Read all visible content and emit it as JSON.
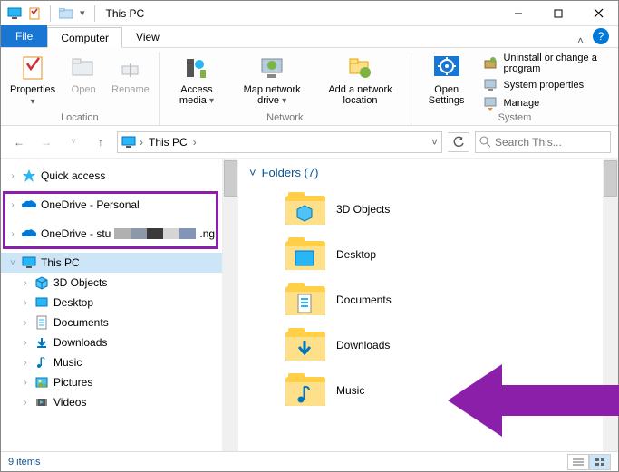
{
  "title": "This PC",
  "tabs": {
    "file": "File",
    "computer": "Computer",
    "view": "View"
  },
  "ribbon": {
    "location": {
      "label": "Location",
      "properties": "Properties",
      "open": "Open",
      "rename": "Rename"
    },
    "network": {
      "label": "Network",
      "access_media": "Access media",
      "map_drive": "Map network drive",
      "add_location": "Add a network location"
    },
    "system": {
      "label": "System",
      "open_settings": "Open Settings",
      "uninstall": "Uninstall or change a program",
      "system_props": "System properties",
      "manage": "Manage"
    }
  },
  "addressbar": {
    "crumb1": "This PC"
  },
  "search_placeholder": "Search This...",
  "nav": {
    "quick_access": "Quick access",
    "onedrive_personal": "OneDrive - Personal",
    "onedrive_student_prefix": "OneDrive - stu",
    "onedrive_student_suffix": ".ng",
    "this_pc": "This PC",
    "n3d": "3D Objects",
    "desktop": "Desktop",
    "documents": "Documents",
    "downloads": "Downloads",
    "music": "Music",
    "pictures": "Pictures",
    "videos": "Videos"
  },
  "content": {
    "section_label": "Folders (7)",
    "items": {
      "f0": "3D Objects",
      "f1": "Desktop",
      "f2": "Documents",
      "f3": "Downloads",
      "f4": "Music"
    }
  },
  "status": "9 items"
}
